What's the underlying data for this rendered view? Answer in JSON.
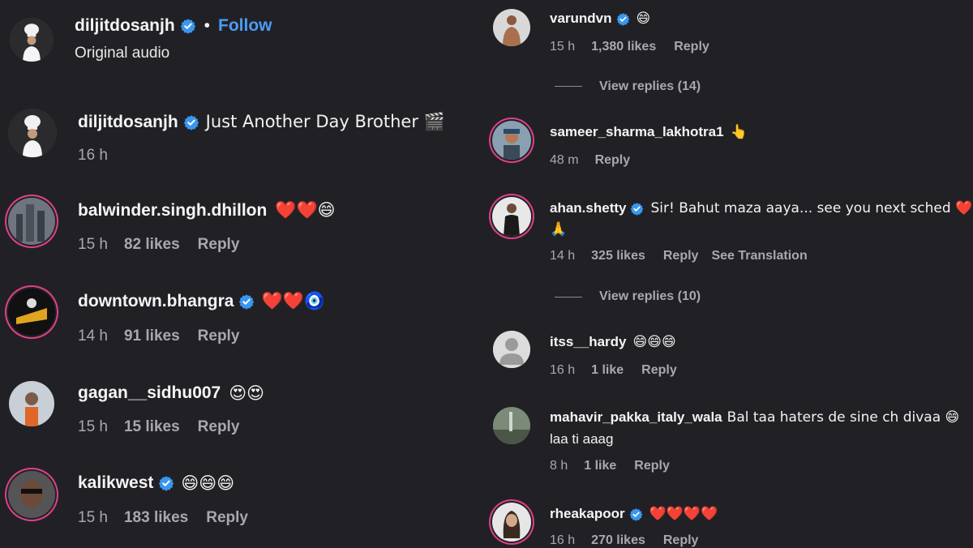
{
  "header": {
    "username": "diljitdosanjh",
    "separator": "•",
    "follow_label": "Follow",
    "audio_label": "Original audio"
  },
  "caption": {
    "username": "diljitdosanjh",
    "text": "Just Another Day Brother 🎬",
    "time": "16 h"
  },
  "left_comments": [
    {
      "username": "balwinder.singh.dhillon",
      "text": "❤️❤️😄",
      "time": "15 h",
      "likes": "82 likes",
      "reply": "Reply",
      "verified": false
    },
    {
      "username": "downtown.bhangra",
      "text": "❤️❤️🧿",
      "time": "14 h",
      "likes": "91 likes",
      "reply": "Reply",
      "verified": true
    },
    {
      "username": "gagan__sidhu007",
      "text": "😍😍",
      "time": "15 h",
      "likes": "15 likes",
      "reply": "Reply",
      "verified": false
    },
    {
      "username": "kalikwest",
      "text": "😄😄😄",
      "time": "15 h",
      "likes": "183 likes",
      "reply": "Reply",
      "verified": true
    }
  ],
  "right_comments": [
    {
      "username": "varundvn",
      "text": "😄",
      "time": "15 h",
      "likes": "1,380 likes",
      "reply": "Reply",
      "verified": true,
      "view_replies": "View replies (14)"
    },
    {
      "username": "sameer_sharma_lakhotra1",
      "text": "👆",
      "time": "48 m",
      "likes": "",
      "reply": "Reply",
      "verified": false
    },
    {
      "username": "ahan.shetty",
      "text": "Sir! Bahut maza aaya... see you next sched ❤️",
      "text2": "🙏",
      "time": "14 h",
      "likes": "325 likes",
      "reply": "Reply",
      "translate": "See Translation",
      "verified": true,
      "view_replies": "View replies (10)"
    },
    {
      "username": "itss__hardy",
      "text": "😄😄😄",
      "time": "16 h",
      "likes": "1 like",
      "reply": "Reply",
      "verified": false
    },
    {
      "username": "mahavir_pakka_italy_wala",
      "text": "Bal taa haters de sine ch divaa 😄",
      "text2": "laa ti aaag",
      "time": "8 h",
      "likes": "1 like",
      "reply": "Reply",
      "verified": false
    },
    {
      "username": "rheakapoor",
      "text": "❤️❤️❤️❤️",
      "time": "16 h",
      "likes": "270 likes",
      "reply": "Reply",
      "verified": true
    }
  ],
  "colors": {
    "background": "#212125",
    "verified": "#3897f0",
    "follow": "#4c9bf5",
    "story_ring": "#e0408a",
    "meta_text": "#a8a8ad"
  }
}
